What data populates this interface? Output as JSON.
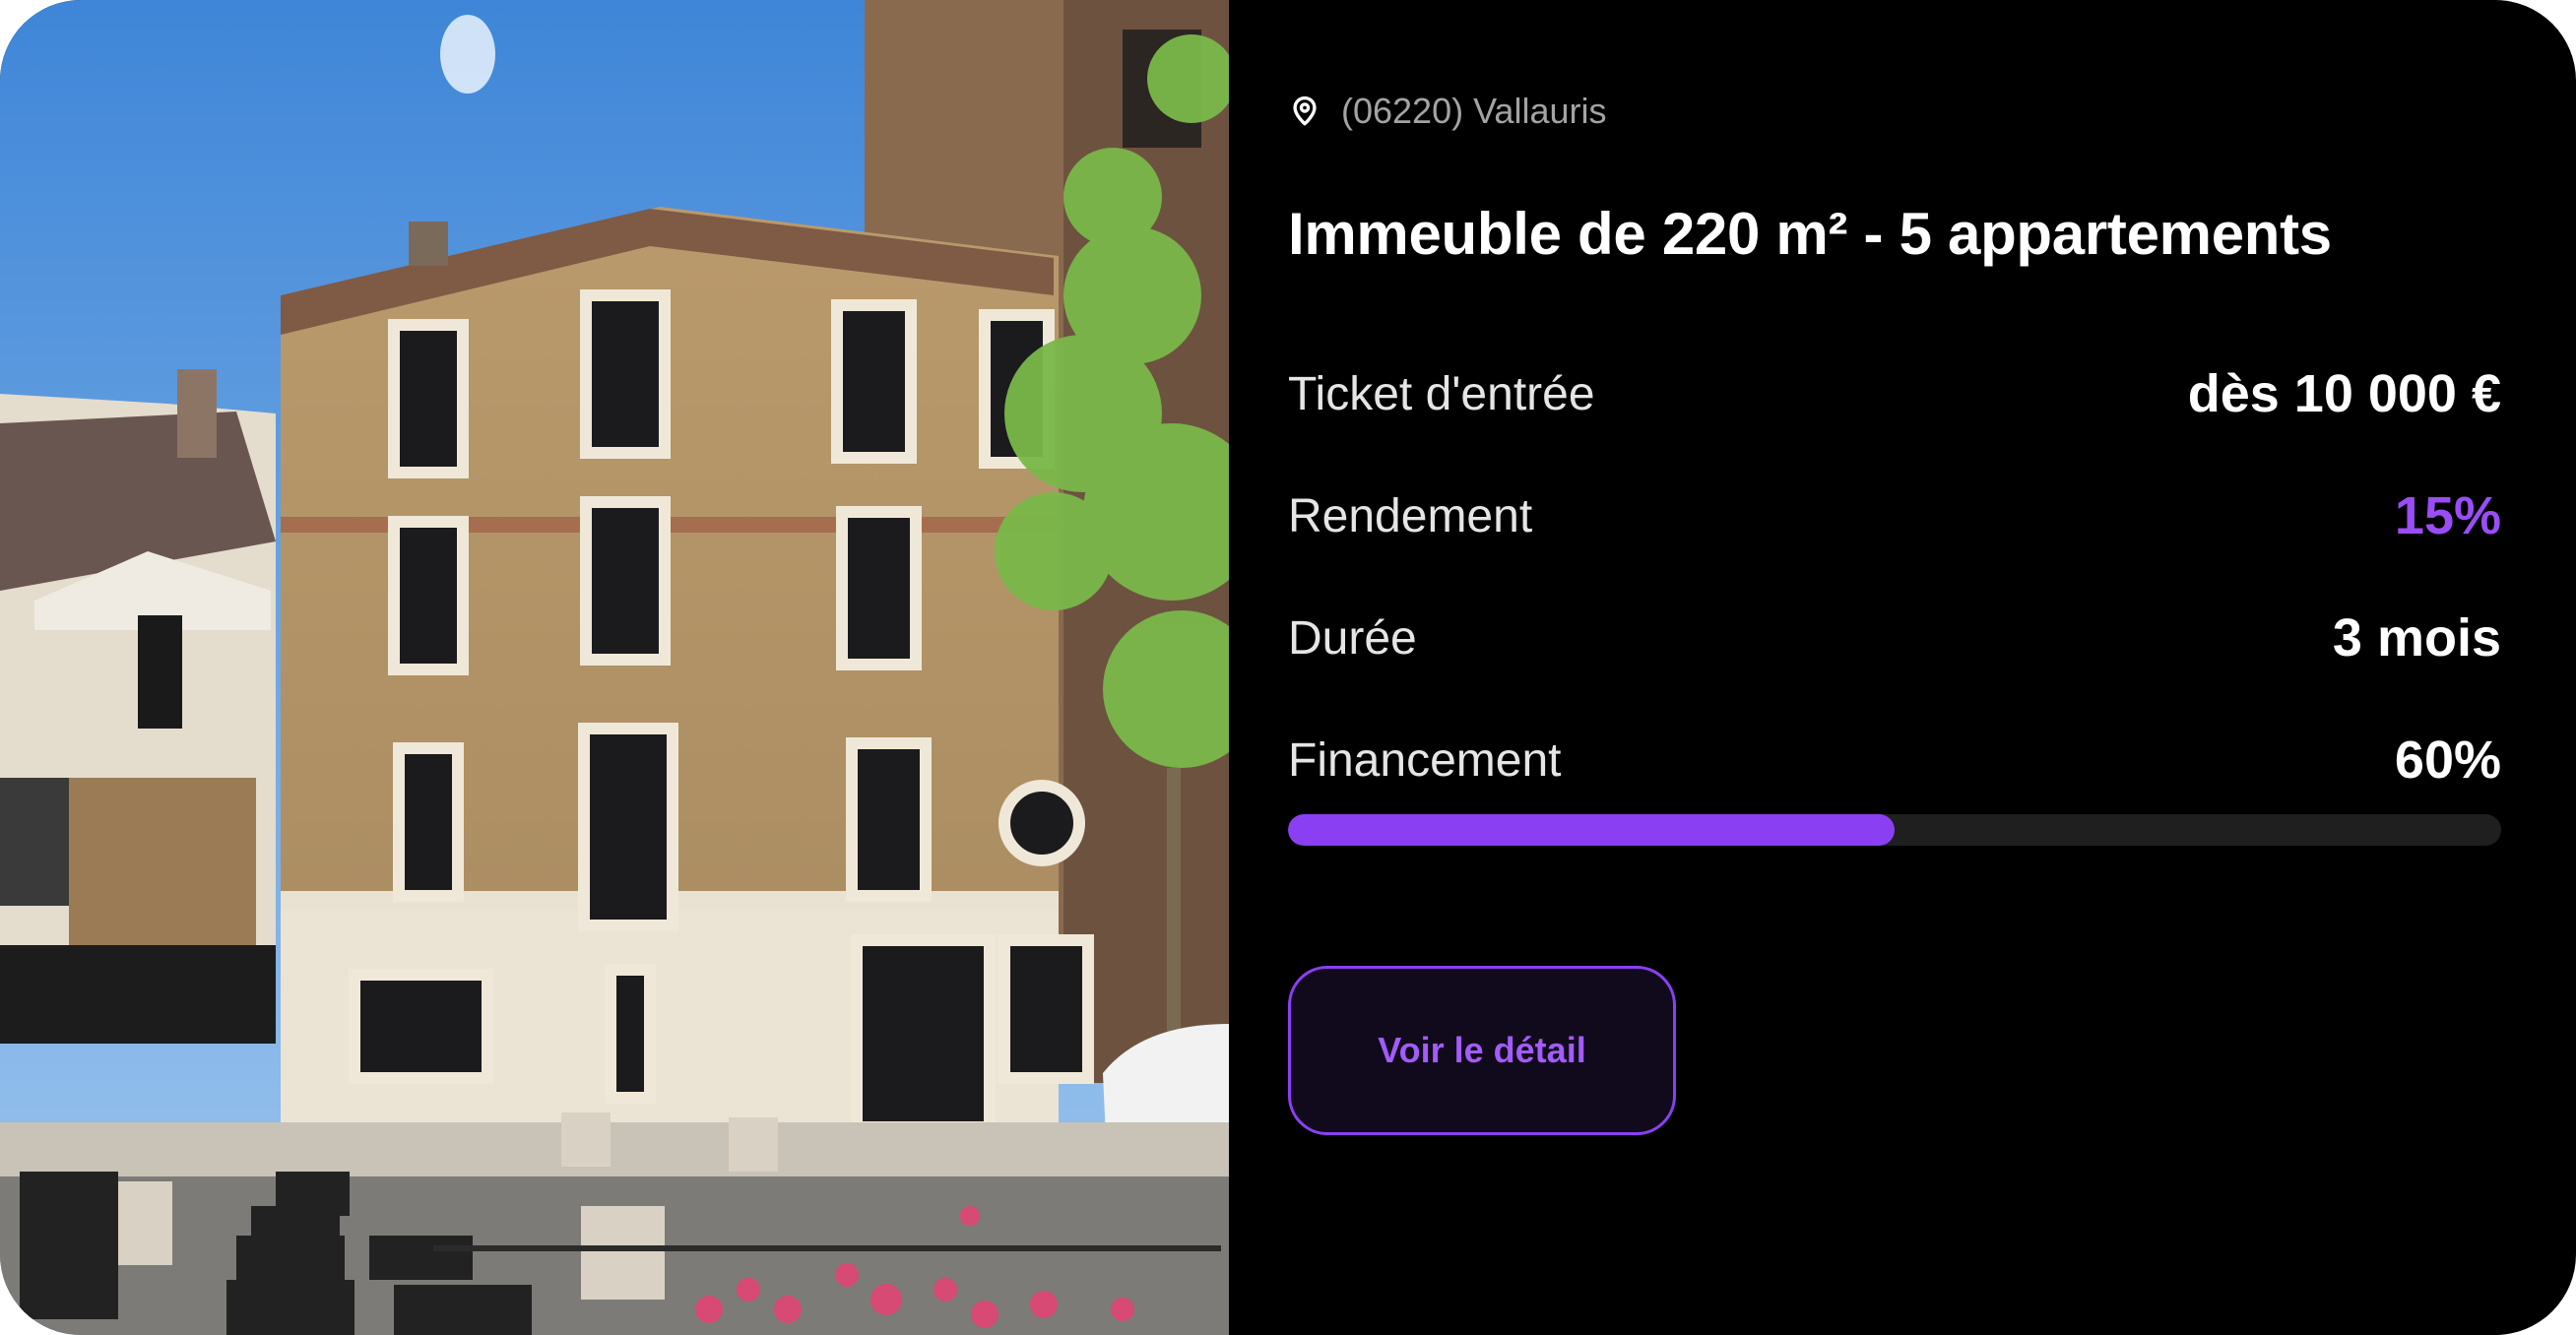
{
  "listing": {
    "location": "(06220) Vallauris",
    "title": "Immeuble de 220 m² - 5 appartements",
    "image_alt": "Immeuble en briques de 4 étages au coin d'une rue"
  },
  "details": [
    {
      "label": "Ticket d'entrée",
      "value": "dès 10 000 €"
    },
    {
      "label": "Rendement",
      "value": "15%"
    },
    {
      "label": "Durée",
      "value": "3 mois"
    },
    {
      "label": "Financement",
      "value": "60%"
    }
  ],
  "funding_progress": 0.5,
  "cta": {
    "label": "Voir le détail"
  },
  "icons": {
    "location": "map-pin-icon"
  },
  "colors": {
    "background": "#000000",
    "accent": "#8b3ff2",
    "accent_text": "#9a4df5",
    "progress_track": "#1f1f1f",
    "muted_text": "#a3a3a3"
  }
}
